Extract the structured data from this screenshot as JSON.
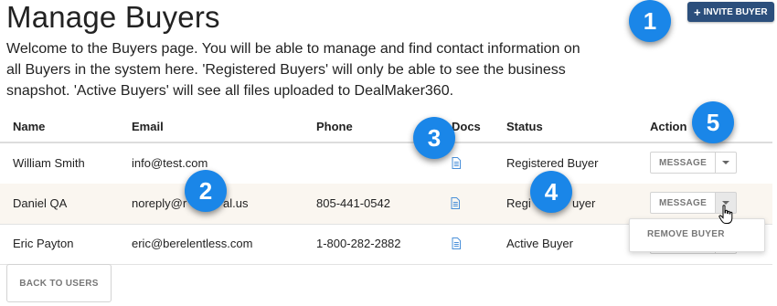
{
  "page": {
    "title": "Manage Buyers",
    "intro": "Welcome to the Buyers page. You will be able to manage and find contact information on all Buyers in the system here. 'Registered Buyers' will only be able to see the business snapshot. 'Active Buyers' will see all files uploaded to DealMaker360."
  },
  "invite_button": {
    "icon": "plus-icon",
    "label": "INVITE BUYER"
  },
  "table": {
    "headers": {
      "name": "Name",
      "email": "Email",
      "phone": "Phone",
      "docs": "Docs",
      "status": "Status",
      "action": "Action"
    },
    "rows": [
      {
        "name": "William Smith",
        "email": "info@test.com",
        "phone": "",
        "status": "Registered Buyer"
      },
      {
        "name": "Daniel QA",
        "email": "noreply@r",
        "email_tail": "al.us",
        "phone": "805-441-0542",
        "status": "Regi",
        "status_tail": "uyer"
      },
      {
        "name": "Eric Payton",
        "email": "eric@berelentless.com",
        "phone": "1-800-282-2882",
        "status": "Active Buyer"
      }
    ],
    "doc_icon": "document-icon",
    "message_label": "MESSAGE",
    "dropdown_icon": "caret-down-icon"
  },
  "dropdown_menu": {
    "items": [
      "REMOVE BUYER"
    ]
  },
  "back_button": {
    "label": "BACK TO USERS"
  },
  "badges": [
    "1",
    "2",
    "3",
    "4",
    "5"
  ],
  "colors": {
    "badge": "#1a86e8",
    "primary_button": "#2c4f7c",
    "doc_icon": "#4a90d9",
    "row_alt": "#faf6f0"
  }
}
